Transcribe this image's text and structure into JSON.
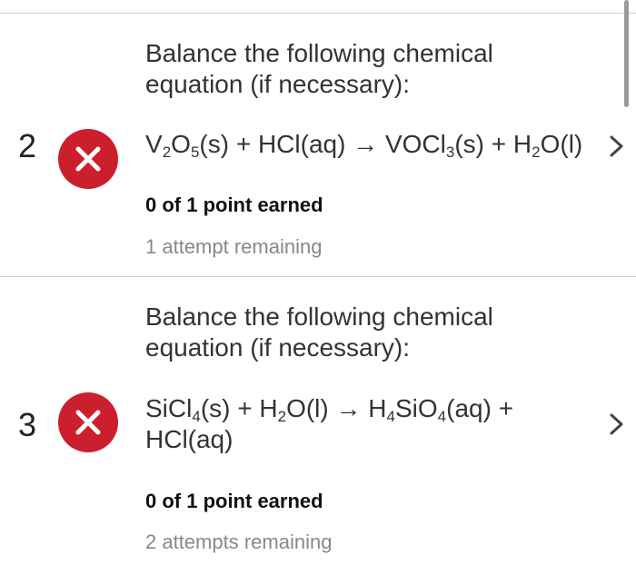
{
  "questions": [
    {
      "number": "2",
      "status": "incorrect",
      "prompt_line1": "Balance the following chemical",
      "prompt_line2": "equation (if necessary):",
      "equation": {
        "p1": "V",
        "s1": "2",
        "p2": "O",
        "s2": "5",
        "p3": "(s) + HCl(aq) → VOCl",
        "s3": "3",
        "p4": "(s) + H",
        "s4": "2",
        "p5": "O(l)"
      },
      "score": "0 of 1 point earned",
      "attempts": "1 attempt remaining"
    },
    {
      "number": "3",
      "status": "incorrect",
      "prompt_line1": "Balance the following chemical",
      "prompt_line2": "equation (if necessary):",
      "equation": {
        "p1": "SiCl",
        "s1": "4",
        "p2": "(s) + H",
        "s2": "2",
        "p3": "O(l) → H",
        "s3": "4",
        "p4": "SiO",
        "s4": "4",
        "p5": "(aq) +",
        "line2": "HCl(aq)"
      },
      "score": "0 of 1 point earned",
      "attempts": "2 attempts remaining"
    }
  ],
  "icons": {
    "status_icon": "x-circle-icon",
    "row_action_icon": "chevron-right-icon"
  },
  "colors": {
    "incorrect": "#cc1f2d",
    "text": "#333333",
    "muted": "#888888",
    "divider": "#cfcfcf"
  }
}
